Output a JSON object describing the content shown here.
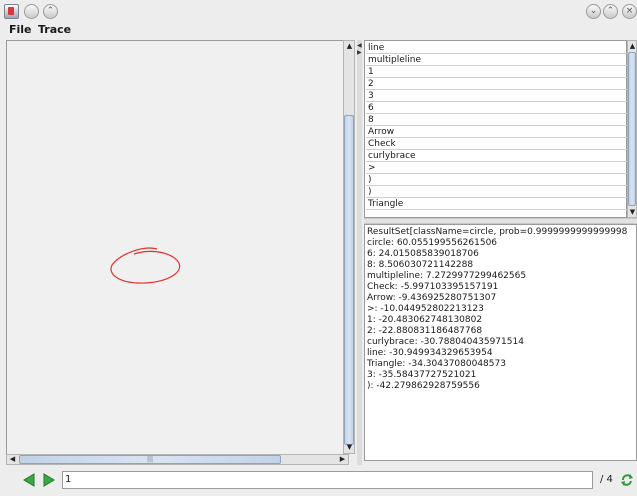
{
  "menu": {
    "file": "File",
    "trace": "Trace"
  },
  "gesture_list": {
    "items": [
      "line",
      "multipleline",
      "1",
      "2",
      "3",
      "6",
      "8",
      "Arrow",
      "Check",
      "curlybrace",
      ">",
      ")",
      ")",
      "Triangle"
    ]
  },
  "results": {
    "lines": [
      "ResultSet[className=circle, prob=0.9999999999999998",
      "circle: 60.055199556261506",
      "6: 24.015085839018706",
      "8: 8.506030721142288",
      "multipleline: 7.2729977299462565",
      "Check: -5.997103395157191",
      "Arrow: -9.436925280751307",
      ">: -10.044952802213123",
      "1: -20.483062748130802",
      "2: -22.880831186487768",
      "curlybrace: -30.788040435971514",
      "line: -30.949934329653954",
      "Triangle: -34.30437080048573",
      "3: -35.58437727521021",
      "): -42.279862928759556"
    ]
  },
  "navigation": {
    "current": "1",
    "total_label": "/ 4"
  },
  "horizontal_scroll": {
    "thumb_label": "|||"
  },
  "colors": {
    "stroke": "#e0302a",
    "thumb": "#c2d2e6"
  },
  "icons": {
    "app": "java-app-icon",
    "prev": "green-left-arrow",
    "next": "green-right-arrow",
    "refresh": "refresh-icon"
  }
}
